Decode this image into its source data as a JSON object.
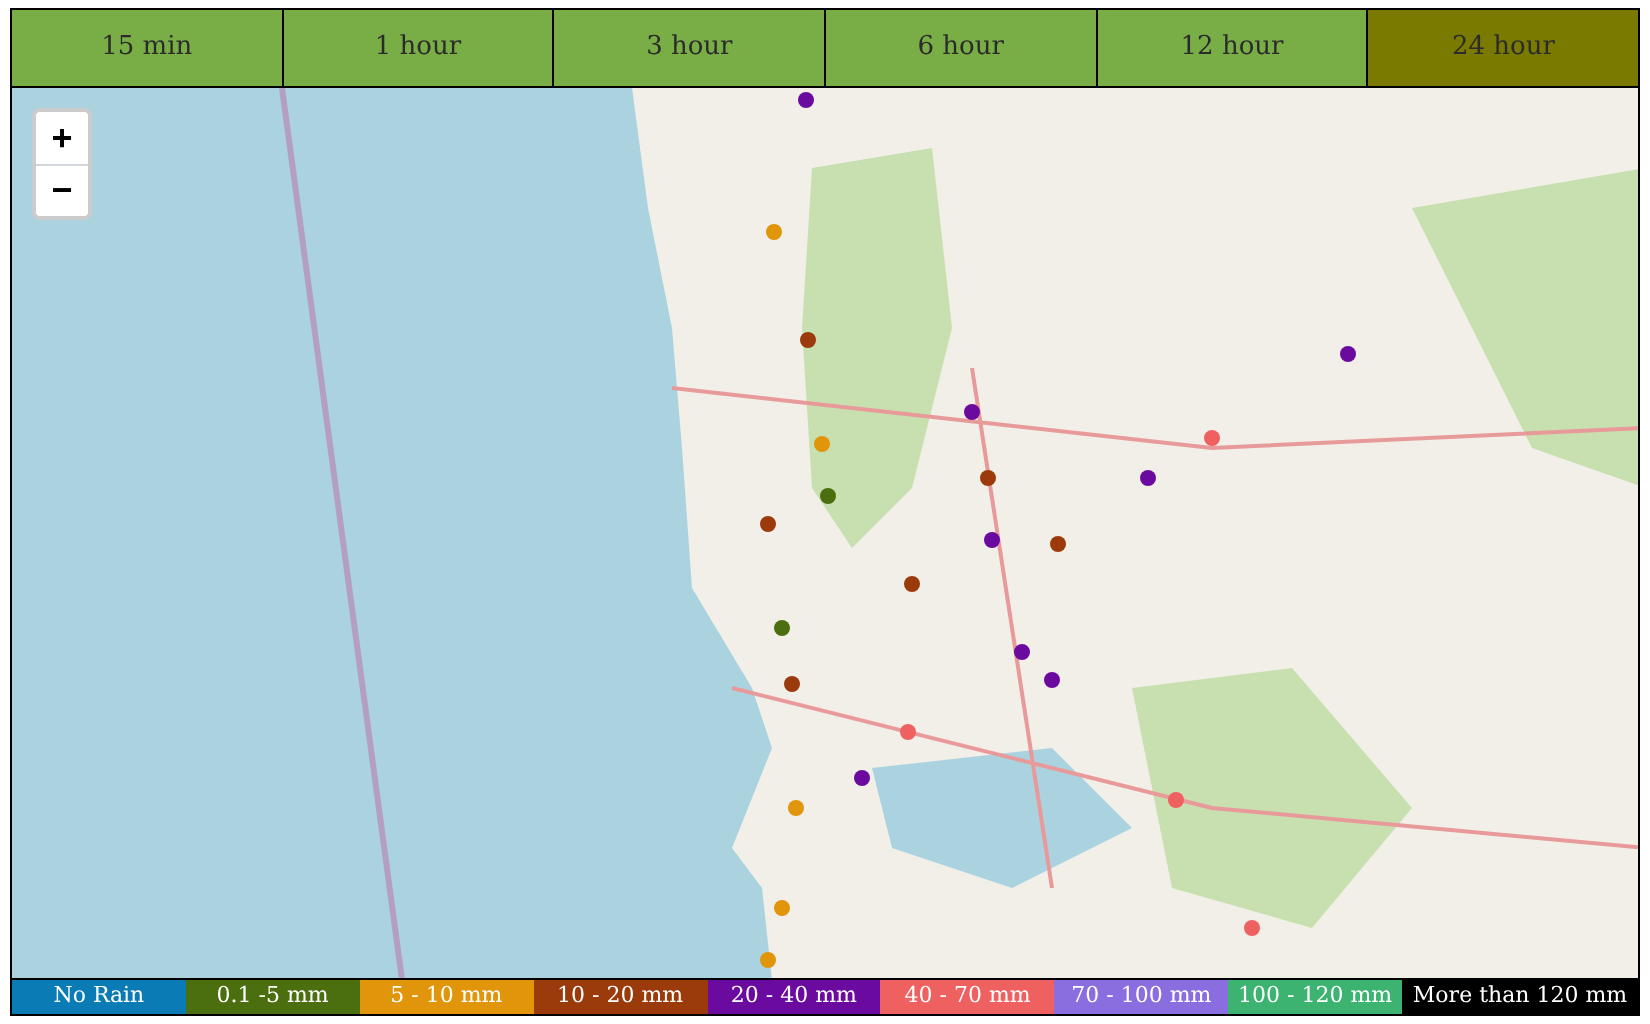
{
  "tabs": [
    {
      "label": "15 min",
      "selected": false
    },
    {
      "label": "1 hour",
      "selected": false
    },
    {
      "label": "3 hour",
      "selected": false
    },
    {
      "label": "6 hour",
      "selected": false
    },
    {
      "label": "12 hour",
      "selected": false
    },
    {
      "label": "24 hour",
      "selected": true
    }
  ],
  "zoom_controls": [
    "+",
    "−"
  ],
  "legend": [
    {
      "label": "No Rain",
      "color": "#0b7bb5"
    },
    {
      "label": "0.1 -5 mm",
      "color": "#4b6e0f"
    },
    {
      "label": "5 - 10 mm",
      "color": "#e0950a"
    },
    {
      "label": "10 - 20 mm",
      "color": "#9b3a0a"
    },
    {
      "label": "20 - 40 mm",
      "color": "#6a0a9e"
    },
    {
      "label": "40 - 70 mm",
      "color": "#ef6060"
    },
    {
      "label": "70 - 100 mm",
      "color": "#8a6ee0"
    },
    {
      "label": "100 - 120 mm",
      "color": "#3cb371"
    },
    {
      "label": "More than 120 mm",
      "color": "#000000"
    }
  ]
}
